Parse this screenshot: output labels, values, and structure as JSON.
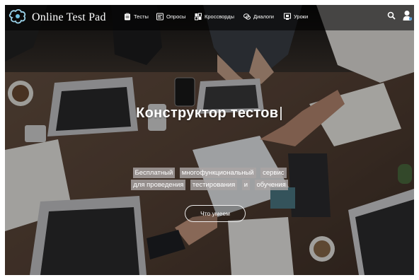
{
  "brand": {
    "name": "Online Test Pad",
    "logo_icon": "puzzle-logo-icon"
  },
  "nav": {
    "items": [
      {
        "label": "Тесты",
        "icon": "clipboard-icon"
      },
      {
        "label": "Опросы",
        "icon": "poll-icon"
      },
      {
        "label": "Кроссворды",
        "icon": "crossword-icon"
      },
      {
        "label": "Диалоги",
        "icon": "dialog-icon"
      },
      {
        "label": "Уроки",
        "icon": "lesson-icon"
      }
    ],
    "search_icon": "search-icon",
    "user_icon": "user-icon"
  },
  "hero": {
    "title": "Конструктор тестов",
    "cursor": "|",
    "subtitle_line1": [
      "Бесплатный",
      "многофункциональный",
      "сервис"
    ],
    "subtitle_line2": [
      "для проведения",
      "тестирования",
      "и",
      "обучения"
    ],
    "cta_label": "Что умеем"
  },
  "colors": {
    "navbar_bg": "#000000",
    "highlight_bg": "#aaa5a5",
    "text": "#ffffff"
  }
}
